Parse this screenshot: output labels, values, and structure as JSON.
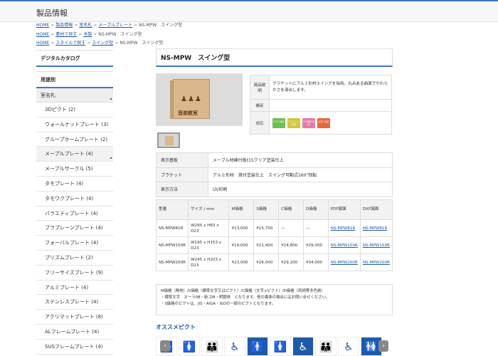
{
  "header": {
    "title": "製品情報"
  },
  "breadcrumbs": [
    {
      "links": [
        "HOME",
        "製品情報",
        "室名札",
        "メープルプレート"
      ],
      "current": "NS-MPW　スイング型"
    },
    {
      "links": [
        "HOME",
        "素材で探す",
        "木製"
      ],
      "current": "NS-MPW　スイング型"
    },
    {
      "links": [
        "HOME",
        "スタイルで探す",
        "スイング型"
      ],
      "current": "NS-MPW　スイング型"
    }
  ],
  "sidebar": {
    "catalog": "デジタルカタログ",
    "usage": "用途別",
    "category": "室名札",
    "items": [
      {
        "label": "3Dピクト (2)"
      },
      {
        "label": "ウォールナットプレート (3)"
      },
      {
        "label": "グループホームプレート (2)"
      },
      {
        "label": "メープルプレート (4)"
      },
      {
        "label": "メープルサークル (5)"
      },
      {
        "label": "タモプレート (4)"
      },
      {
        "label": "タモワクプレート (4)"
      },
      {
        "label": "バラエティプレート (4)"
      },
      {
        "label": "ブラプレーンプレート (4)"
      },
      {
        "label": "フォーバルプレート (4)"
      },
      {
        "label": "プリズムプレート (2)"
      },
      {
        "label": "フリーサイズプレート (9)"
      },
      {
        "label": "アルミプレート (4)"
      },
      {
        "label": "ステンレスプレート (4)"
      },
      {
        "label": "アクリマットプレート (8)"
      },
      {
        "label": "ALフレームプレート (4)"
      },
      {
        "label": "SUSフレームプレート (4)"
      }
    ]
  },
  "product": {
    "title": "NS-MPW　スイング型",
    "image_sign_text": "音楽教室",
    "spec": {
      "desc_label": "商品説明",
      "desc_value": "ブラケットにアルミ形材スイングを採用。丸みある曲面でやわらかさを演出します。",
      "note_label": "補足",
      "note_value": "",
      "compat_label": "対応",
      "badges": [
        {
          "text": "ECO 対応",
          "color": "#6cbf4f"
        },
        {
          "text": "ソルベント 対応",
          "color": "#d5c43a"
        },
        {
          "text": "UV印刷 対応",
          "color": "#e67aa6"
        },
        {
          "text": "点字 対応",
          "color": "#e8683c"
        }
      ]
    },
    "attrs": [
      {
        "label": "表示基板",
        "value": "メープル材練付板t15クリア塗装仕上"
      },
      {
        "label": "ブラケット",
        "value": "アルミ形材　焼付塗装仕上　スイング可動式160°回転"
      },
      {
        "label": "表示方法",
        "value": "UV印刷"
      }
    ],
    "price_table": {
      "headers": [
        "型番",
        "サイズ / mm",
        "M価格",
        "S価格",
        "C価格",
        "D価格",
        "PDF図面",
        "DXF図面"
      ],
      "rows": [
        {
          "model": "NS-MPW81R",
          "size": "W295 x H83 x D23",
          "m": "¥13,000",
          "s": "¥15,700",
          "c": "---",
          "d": "---",
          "pdf": "NS-MPW81R",
          "dxf": "NS-MPW81R"
        },
        {
          "model": "NS-MPW150R",
          "size": "W195 x H153 x D23",
          "m": "¥19,000",
          "s": "¥21,400",
          "c": "¥24,800",
          "d": "¥29,000",
          "pdf": "NS-MPW150R",
          "dxf": "NS-MPW150R"
        },
        {
          "model": "NS-MPW200R",
          "size": "W245 x H203 x D23",
          "m": "¥23,000",
          "s": "¥26,000",
          "c": "¥29,200",
          "d": "¥34,000",
          "pdf": "NS-MPW200R",
          "dxf": "NS-MPW200R"
        }
      ]
    },
    "notes": [
      "M価格（無地）/S価格（標準文字又はピクト）/C価格（文字+ピクト）/D価格（両柄等多色刷）",
      "・標準文字　ヌーラ0B・新ゴM・明朝体　となります。他の書体の場合にはお問い合せください。",
      "・S価格のピクトは、JIS・AIGA・ISOの一部のピクトとなります。"
    ]
  },
  "recommend": {
    "title": "オススメピクト",
    "icons": [
      {
        "icon": "toilet-men-women-icon",
        "glyph": "🚻",
        "style": "plain"
      },
      {
        "icon": "toilet-women-icon",
        "glyph": "🚺",
        "style": "red"
      },
      {
        "icon": "toilet-family-icon",
        "glyph": "👪",
        "style": "red"
      },
      {
        "icon": "wheelchair-icon",
        "glyph": "♿",
        "style": "dark"
      },
      {
        "icon": "men-blue-icon",
        "glyph": "🚹",
        "style": "blue"
      },
      {
        "icon": "women-red-icon",
        "glyph": "🚺",
        "style": "red"
      },
      {
        "icon": "wheelchair-blue-icon",
        "glyph": "♿",
        "style": "blue"
      },
      {
        "icon": "family-icon",
        "glyph": "👪",
        "style": "dark"
      },
      {
        "icon": "accessible-icon",
        "glyph": "♿",
        "style": "dark"
      },
      {
        "icon": "toilet-blue-icon",
        "glyph": "🚻",
        "style": "blue"
      }
    ]
  }
}
